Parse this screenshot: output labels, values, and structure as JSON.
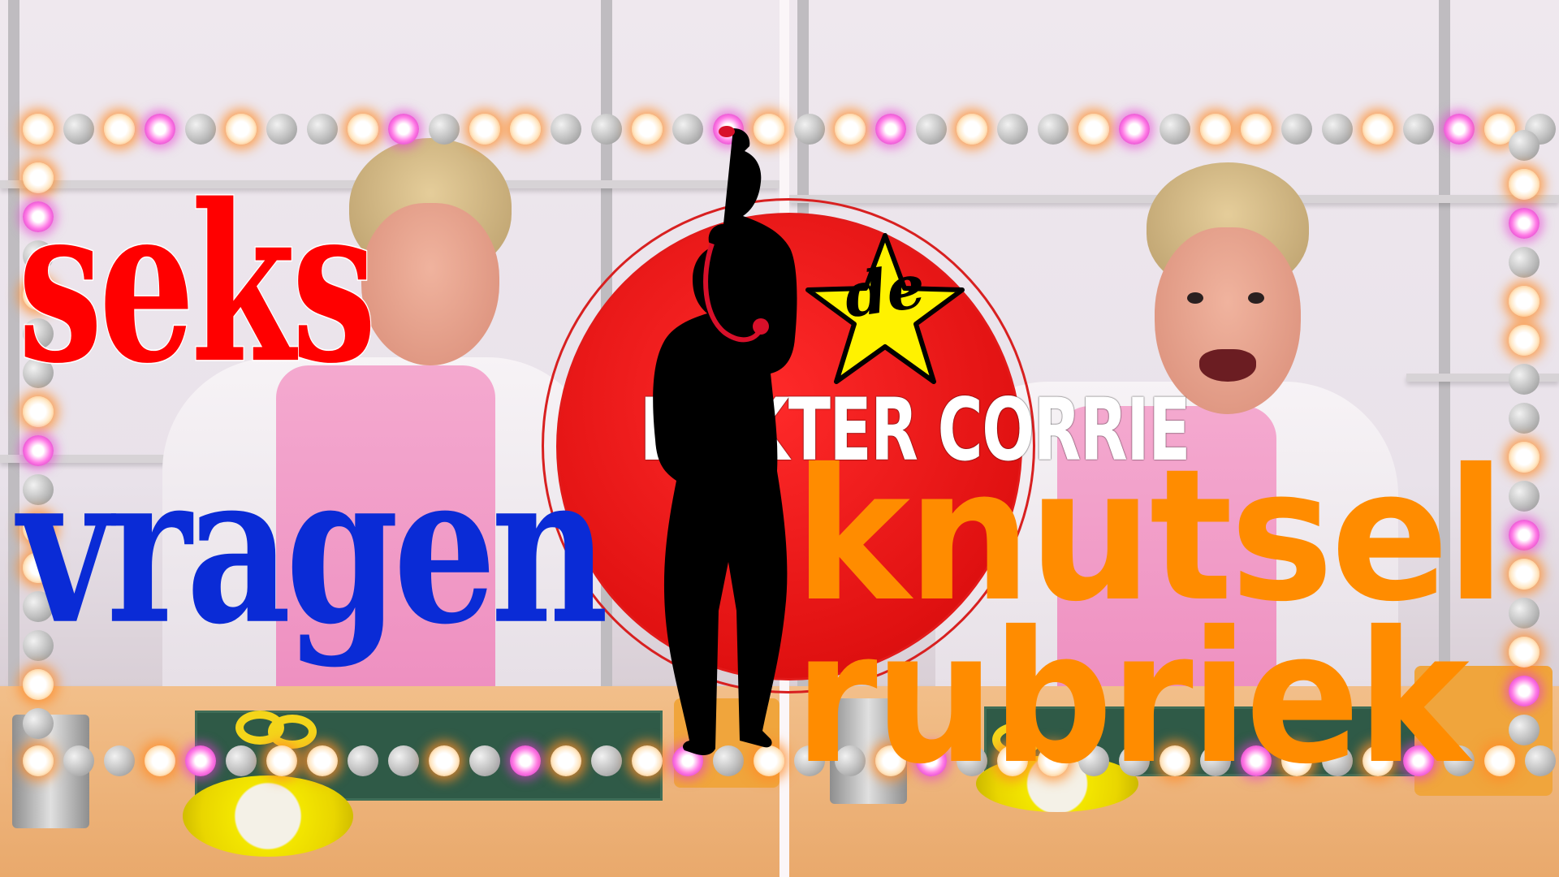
{
  "logo": {
    "star_label": "de",
    "title": "DOKTER CORRIE"
  },
  "headline": {
    "line1": "seks",
    "line2": "vragen",
    "line3": "knutsel",
    "line4": "rubriek"
  },
  "colors": {
    "seks": "#ff0000",
    "vragen": "#0a2bd6",
    "knutsel_rubriek": "#ff8c00",
    "logo_red": "#e01111",
    "star_yellow": "#fff200",
    "bulb_glow": "#ff9b3d",
    "bulb_pink": "#ff7ce6"
  }
}
